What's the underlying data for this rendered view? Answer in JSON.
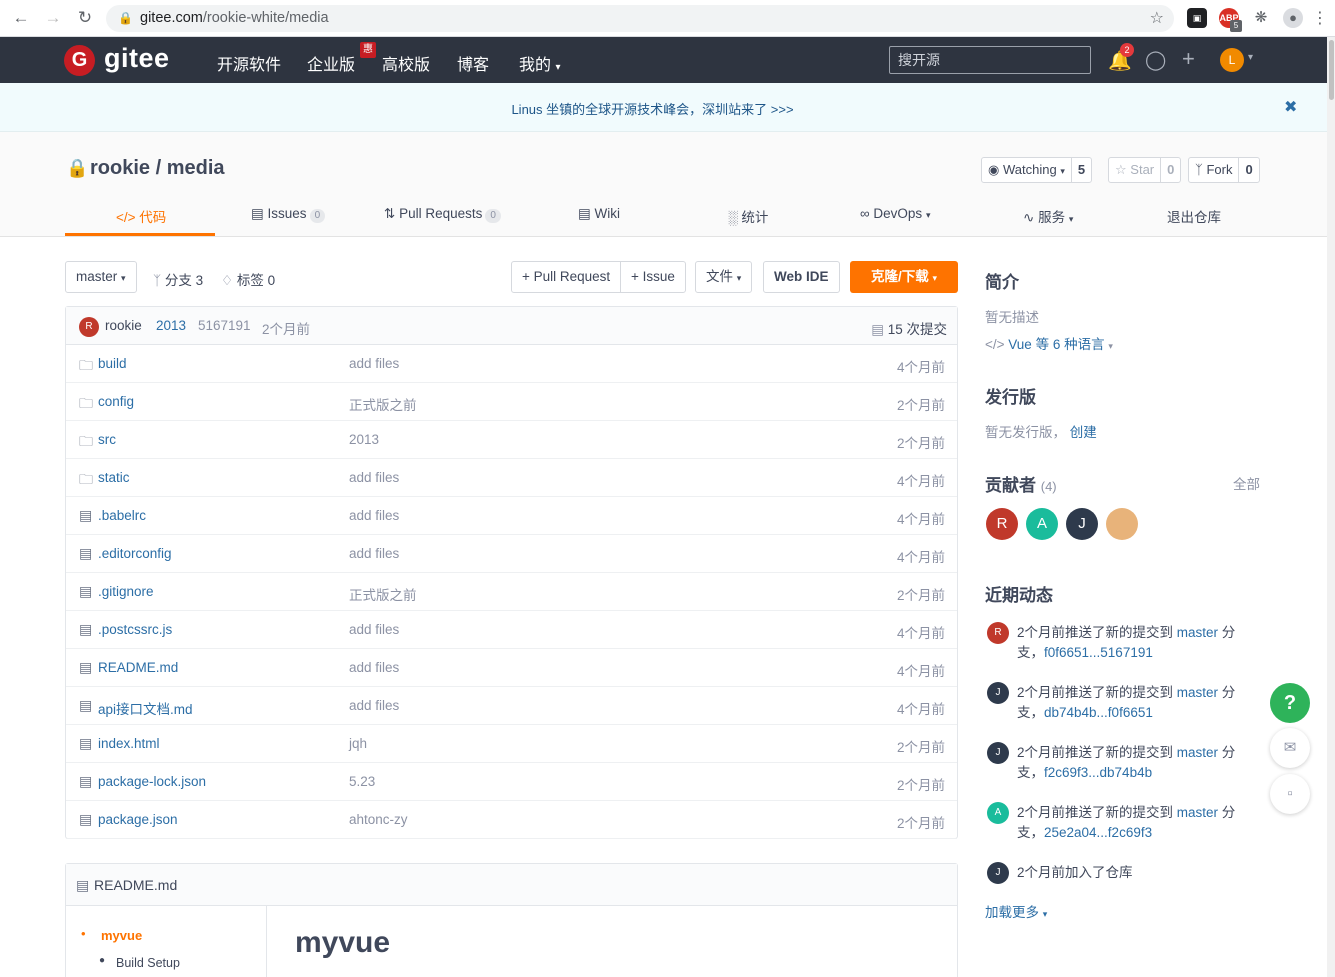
{
  "browser": {
    "url_host": "gitee.com",
    "url_path": "/rookie-white/media",
    "ext_abp_badge": "5"
  },
  "header": {
    "logo_letter": "G",
    "logo_text": "gitee",
    "nav": [
      "开源软件",
      "企业版",
      "高校版",
      "博客",
      "我的"
    ],
    "hot_badge": "惠",
    "search_placeholder": "搜开源",
    "notify_count": "2",
    "avatar_letter": "L"
  },
  "banner": {
    "text": "Linus 坐镇的全球开源技术峰会，深圳站来了 >>>"
  },
  "repo": {
    "title": "rookie / media",
    "watching": {
      "label": "Watching",
      "count": "5"
    },
    "star": {
      "label": "Star",
      "count": "0"
    },
    "fork": {
      "label": "Fork",
      "count": "0"
    },
    "tabs": [
      {
        "label": "代码",
        "badge": ""
      },
      {
        "label": "Issues",
        "badge": "0"
      },
      {
        "label": "Pull Requests",
        "badge": "0"
      },
      {
        "label": "Wiki",
        "badge": ""
      },
      {
        "label": "统计",
        "badge": ""
      },
      {
        "label": "DevOps",
        "badge": ""
      },
      {
        "label": "服务",
        "badge": ""
      },
      {
        "label": "退出仓库",
        "badge": ""
      }
    ]
  },
  "toolbar": {
    "branch": "master",
    "branches": "分支 3",
    "tags": "标签 0",
    "pull_request": "+ Pull Request",
    "issue": "+ Issue",
    "file": "文件",
    "webide": "Web IDE",
    "clone": "克隆/下载"
  },
  "commit": {
    "avatar": "R",
    "author": "rookie",
    "message": "2013",
    "hash": "5167191",
    "time": "2个月前",
    "total": "15 次提交"
  },
  "files": [
    {
      "name": "build",
      "type": "folder",
      "msg": "add files",
      "time": "4个月前"
    },
    {
      "name": "config",
      "type": "folder",
      "msg": "正式版之前",
      "time": "2个月前"
    },
    {
      "name": "src",
      "type": "folder",
      "msg": "2013",
      "time": "2个月前"
    },
    {
      "name": "static",
      "type": "folder",
      "msg": "add files",
      "time": "4个月前"
    },
    {
      "name": ".babelrc",
      "type": "file",
      "msg": "add files",
      "time": "4个月前"
    },
    {
      "name": ".editorconfig",
      "type": "file",
      "msg": "add files",
      "time": "4个月前"
    },
    {
      "name": ".gitignore",
      "type": "file",
      "msg": "正式版之前",
      "time": "2个月前"
    },
    {
      "name": ".postcssrc.js",
      "type": "file",
      "msg": "add files",
      "time": "4个月前"
    },
    {
      "name": "README.md",
      "type": "file",
      "msg": "add files",
      "time": "4个月前"
    },
    {
      "name": "api接口文档.md",
      "type": "file",
      "msg": "add files",
      "time": "4个月前"
    },
    {
      "name": "index.html",
      "type": "file",
      "msg": "jqh",
      "time": "2个月前"
    },
    {
      "name": "package-lock.json",
      "type": "file",
      "msg": "5.23",
      "time": "2个月前"
    },
    {
      "name": "package.json",
      "type": "file",
      "msg": "ahtonc-zy",
      "time": "2个月前"
    }
  ],
  "readme": {
    "title": "README.md",
    "toc": [
      "myvue",
      "Build Setup"
    ],
    "heading": "myvue"
  },
  "sidebar": {
    "intro_title": "简介",
    "intro_desc": "暂无描述",
    "lang": "Vue 等 6 种语言",
    "release_title": "发行版",
    "release_desc": "暂无发行版，",
    "release_create": "创建",
    "contrib_title": "贡献者",
    "contrib_count": "(4)",
    "contrib_all": "全部",
    "contributors": [
      {
        "letter": "R",
        "color": "#c0392b"
      },
      {
        "letter": "A",
        "color": "#1abc9c"
      },
      {
        "letter": "J",
        "color": "#2e3a4c"
      },
      {
        "letter": "",
        "color": "#e8b37a"
      }
    ],
    "activity_title": "近期动态",
    "activities": [
      {
        "avatar": "R",
        "color": "#c0392b",
        "text": "2个月前推送了新的提交到 ",
        "branch": "master",
        "suffix": " 分支，",
        "link": "f0f6651...5167191"
      },
      {
        "avatar": "J",
        "color": "#2e3a4c",
        "text": "2个月前推送了新的提交到 ",
        "branch": "master",
        "suffix": " 分支，",
        "link": "db74b4b...f0f6651"
      },
      {
        "avatar": "J",
        "color": "#2e3a4c",
        "text": "2个月前推送了新的提交到 ",
        "branch": "master",
        "suffix": " 分支，",
        "link": "f2c69f3...db74b4b"
      },
      {
        "avatar": "A",
        "color": "#1abc9c",
        "text": "2个月前推送了新的提交到 ",
        "branch": "master",
        "suffix": " 分支，",
        "link": "25e2a04...f2c69f3"
      },
      {
        "avatar": "J",
        "color": "#2e3a4c",
        "text": "2个月前加入了仓库",
        "branch": "",
        "suffix": "",
        "link": ""
      }
    ],
    "load_more": "加载更多"
  },
  "float": {
    "help": "?"
  }
}
